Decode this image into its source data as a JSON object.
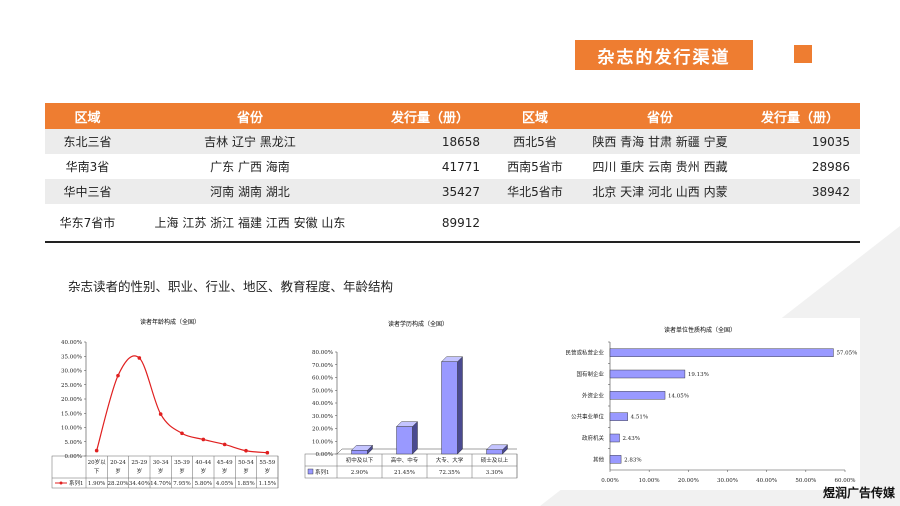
{
  "title": "杂志的发行渠道",
  "table": {
    "headers": [
      "区域",
      "省份",
      "发行量（册）",
      "区域",
      "省份",
      "发行量（册）"
    ],
    "rows": [
      [
        "东北三省",
        "吉林 辽宁 黑龙江",
        "18658",
        "西北5省",
        "陕西 青海 甘肃 新疆 宁夏",
        "19035"
      ],
      [
        "华南3省",
        "广东 广西 海南",
        "41771",
        "西南5省市",
        "四川 重庆 云南 贵州 西藏",
        "28986"
      ],
      [
        "华中三省",
        "河南 湖南 湖北",
        "35427",
        "华北5省市",
        "北京 天津 河北 山西 内蒙",
        "38942"
      ],
      [
        "华东7省市",
        "上海 江苏 浙江 福建 江西 安徽 山东",
        "89912",
        "",
        "",
        ""
      ]
    ]
  },
  "subtitle": "杂志读者的性别、职业、行业、地区、教育程度、年龄结构",
  "brand": "煜润广告传媒",
  "colors": {
    "accent": "#ee7d31",
    "line": "#e02020",
    "bar": "#9999ff"
  },
  "chart_data": [
    {
      "type": "line",
      "title": "读者年龄构成（全国）",
      "categories": [
        "20岁以下",
        "20-24岁",
        "25-29岁",
        "30-34岁",
        "35-39岁",
        "40-44岁",
        "45-49岁",
        "50-54岁",
        "55-59岁"
      ],
      "series": [
        {
          "name": "系列1",
          "values": [
            1.9,
            28.2,
            34.4,
            14.7,
            7.95,
            5.8,
            4.05,
            1.85,
            1.15
          ]
        }
      ],
      "table_values": [
        "1.90%",
        "28.20%",
        "34.40%",
        "14.70%",
        "7.95%",
        "5.80%",
        "4.05%",
        "1.85%",
        "1.15%"
      ],
      "yticks": [
        "0.00%",
        "5.00%",
        "10.00%",
        "15.00%",
        "20.00%",
        "25.00%",
        "30.00%",
        "35.00%",
        "40.00%"
      ],
      "ylim": [
        0,
        40
      ]
    },
    {
      "type": "bar",
      "title": "读者学历构成（全国）",
      "categories": [
        "初中及以下",
        "高中、中专",
        "大专、大学",
        "硕士及以上"
      ],
      "series": [
        {
          "name": "系列1",
          "values": [
            2.9,
            21.45,
            72.35,
            3.3
          ]
        }
      ],
      "table_values": [
        "2.90%",
        "21.45%",
        "72.35%",
        "3.30%"
      ],
      "yticks": [
        "0.00%",
        "10.00%",
        "20.00%",
        "30.00%",
        "40.00%",
        "50.00%",
        "60.00%",
        "70.00%",
        "80.00%"
      ],
      "ylim": [
        0,
        80
      ]
    },
    {
      "type": "bar",
      "orientation": "horizontal",
      "title": "读者单位性质构成（全国）",
      "categories": [
        "民营或私营企业",
        "国有制企业",
        "外资企业",
        "公共事业单位",
        "政府机关",
        "其他"
      ],
      "values": [
        57.05,
        19.13,
        14.05,
        4.51,
        2.43,
        2.83
      ],
      "value_labels": [
        "57.05%",
        "19.13%",
        "14.05%",
        "4.51%",
        "2.43%",
        "2.83%"
      ],
      "xticks": [
        "0.00%",
        "10.00%",
        "20.00%",
        "30.00%",
        "40.00%",
        "50.00%",
        "60.00%"
      ],
      "xlim": [
        0,
        60
      ]
    }
  ]
}
